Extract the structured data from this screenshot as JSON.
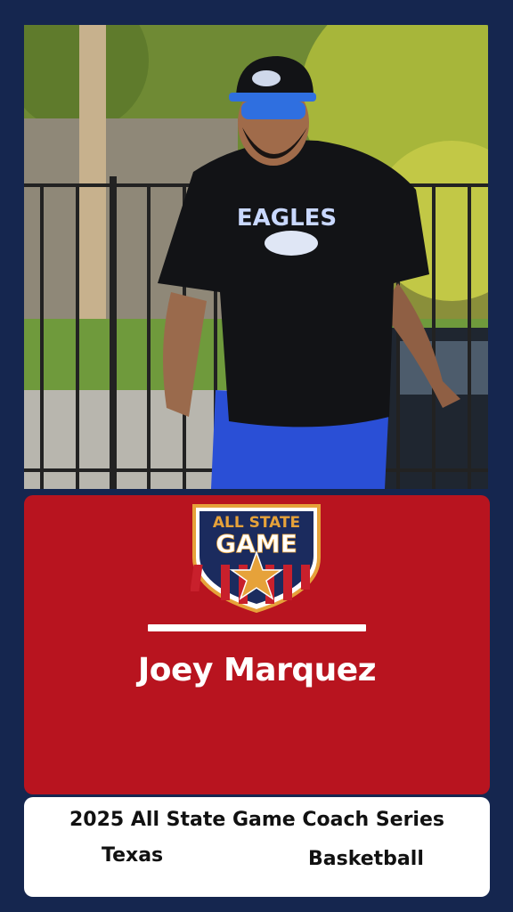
{
  "logo": {
    "line1": "ALL STATE",
    "line2": "GAME"
  },
  "coach": {
    "name": "Joey Marquez"
  },
  "footer": {
    "series": "2025 All State Game Coach Series",
    "state": "Texas",
    "sport": "Basketball"
  },
  "photo": {
    "shirt_text": "EAGLES"
  },
  "colors": {
    "background": "#14244e",
    "banner_red": "#b8141f",
    "footer_white": "#ffffff"
  }
}
